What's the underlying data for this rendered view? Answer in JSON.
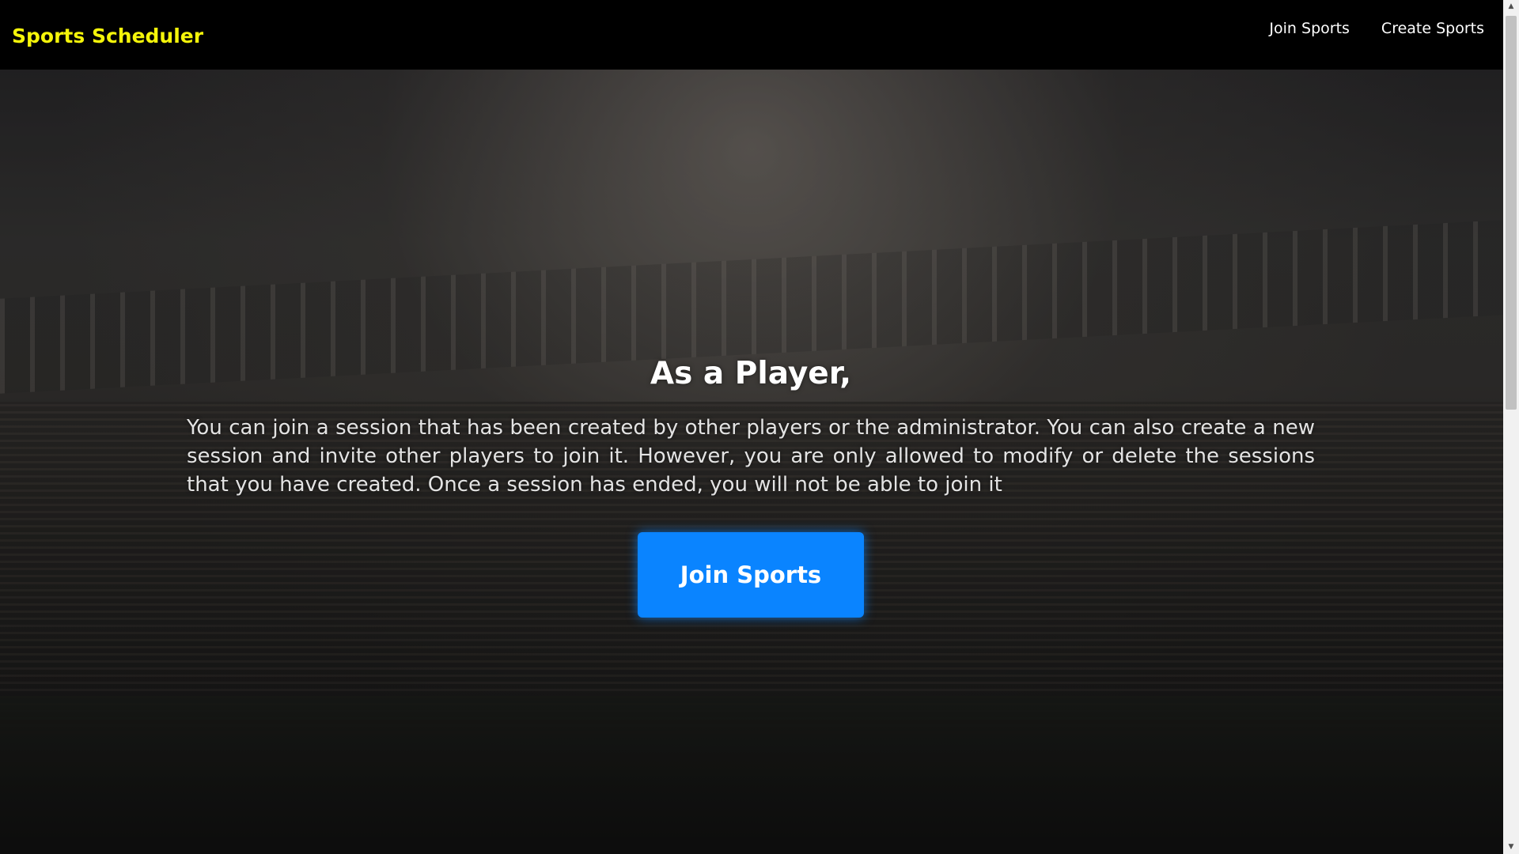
{
  "navbar": {
    "brand": "Sports Scheduler",
    "links": [
      {
        "label": "Join Sports"
      },
      {
        "label": "Create Sports"
      }
    ]
  },
  "hero": {
    "heading": "As a Player,",
    "description": "You can join a session that has been created by other players or the administrator. You can also create a new session and invite other players to join it. However, you are only allowed to modify or delete the sessions that you have created. Once a session has ended, you will not be able to join it",
    "button_label": "Join Sports"
  },
  "colors": {
    "brand": "#f5f50a",
    "navbar_bg": "#000000",
    "button_bg": "#0a84ff"
  },
  "icons": {
    "scroll_up": "chevron-up-icon",
    "scroll_down": "chevron-down-icon"
  }
}
